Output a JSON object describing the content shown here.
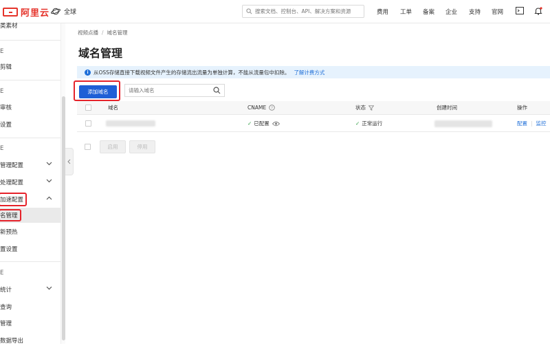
{
  "topbar": {
    "logo_text": "阿里云",
    "region": "全球",
    "search_placeholder": "搜索文档、控制台、API、解决方案和资源",
    "nav": [
      "费用",
      "工单",
      "备案",
      "企业",
      "支持",
      "官网"
    ],
    "accent": "#e5332a"
  },
  "sidebar": {
    "items": [
      {
        "label": "类素材",
        "y": 0
      },
      {
        "label": "E",
        "y": 0
      },
      {
        "label": "剪辑",
        "y": 0
      },
      {
        "label": "E",
        "y": 0
      },
      {
        "label": "审核",
        "y": 0
      },
      {
        "label": "设置",
        "y": 0
      },
      {
        "label": "E",
        "y": 0
      },
      {
        "label": "管理配置",
        "y": 0
      },
      {
        "label": "处理配置",
        "y": 0
      },
      {
        "label": "加速配置",
        "y": 0
      },
      {
        "label": "名管理",
        "y": 0
      },
      {
        "label": "新预热",
        "y": 0
      },
      {
        "label": "置设置",
        "y": 0
      },
      {
        "label": "E",
        "y": 0
      },
      {
        "label": "统计",
        "y": 0
      },
      {
        "label": "查询",
        "y": 0
      },
      {
        "label": "管理",
        "y": 0
      },
      {
        "label": "数据导出",
        "y": 0
      }
    ]
  },
  "breadcrumb": {
    "parent": "视频点播",
    "sep": "/",
    "current": "域名管理"
  },
  "page_title": "域名管理",
  "notice": {
    "text": "从OSS存储直接下载视频文件产生的存储流出流量为单独计算，不能从流量包中扣除。",
    "link": "了解计费方式"
  },
  "toolbar": {
    "add_label": "添加域名",
    "search_placeholder": "请输入域名"
  },
  "table": {
    "headers": {
      "domain": "域名",
      "cname": "CNAME",
      "status": "状态",
      "created": "创建时间",
      "actions": "操作"
    },
    "rows": [
      {
        "cname": "已配置",
        "status": "正常运行",
        "action_config": "配置",
        "action_monitor": "监控"
      }
    ]
  },
  "bulk": {
    "enable": "启用",
    "disable": "停用"
  },
  "colors": {
    "primary": "#1f5fd6",
    "highlight": "#e5222a",
    "success": "#2f9e44",
    "notice_bg": "#e6f2fd"
  }
}
